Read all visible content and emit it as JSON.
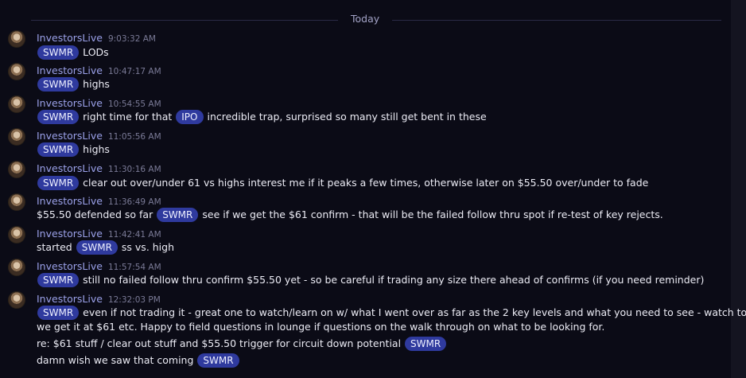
{
  "divider_label": "Today",
  "messages": [
    {
      "author": "InvestorsLive",
      "time": "9:03:32 AM"
    },
    {
      "author": "InvestorsLive",
      "time": "10:47:17 AM"
    },
    {
      "author": "InvestorsLive",
      "time": "10:54:55 AM"
    },
    {
      "author": "InvestorsLive",
      "time": "11:05:56 AM"
    },
    {
      "author": "InvestorsLive",
      "time": "11:30:16 AM"
    },
    {
      "author": "InvestorsLive",
      "time": "11:36:49 AM"
    },
    {
      "author": "InvestorsLive",
      "time": "11:42:41 AM"
    },
    {
      "author": "InvestorsLive",
      "time": "11:57:54 AM"
    },
    {
      "author": "InvestorsLive",
      "time": "12:32:03 PM"
    }
  ],
  "lines": {
    "m1": {
      "tag1": "SWMR",
      "t1": "LODs"
    },
    "m2": {
      "tag1": "SWMR",
      "t1": "highs"
    },
    "m3": {
      "tag1": "SWMR",
      "t1": "right time for that",
      "tag2": "IPO",
      "t2": "incredible trap, surprised so many still get bent in these"
    },
    "m4": {
      "tag1": "SWMR",
      "t1": "highs"
    },
    "m5": {
      "tag1": "SWMR",
      "t1": "clear out over/under 61 vs highs interest me if it peaks a few times, otherwise later on $55.50 over/under to fade"
    },
    "m6": {
      "t0": "$55.50 defended so far",
      "tag1": "SWMR",
      "t1": "see if we get the $61 confirm - that will be the failed follow thru spot if re-test of key rejects."
    },
    "m7": {
      "t0": "started",
      "tag1": "SWMR",
      "t1": "ss vs. high"
    },
    "m8": {
      "tag1": "SWMR",
      "t1": "still no failed follow thru confirm $55.50 yet - so be careful if trading any size there ahead of confirms (if you need reminder)"
    },
    "m9": {
      "tag1": "SWMR",
      "t1": "even if not trading it - great one to watch/learn on w/ what I went over as far as the 2 key levels and what you need to see - watch to see if",
      "t2": "we get it at $61 etc. Happy to field questions in lounge if questions on the walk through on what to be looking for."
    },
    "m10": {
      "t0": "re: $61 stuff / clear out stuff and $55.50 trigger for circuit down potential",
      "tag1": "SWMR"
    },
    "m11": {
      "t0": "damn wish we saw that coming",
      "tag1": "SWMR"
    }
  }
}
